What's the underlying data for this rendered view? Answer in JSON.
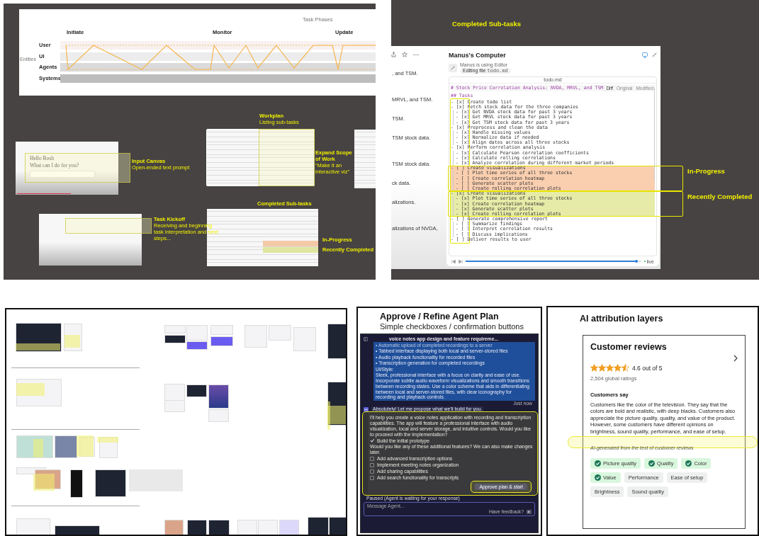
{
  "timeline": {
    "title": "Task Phases",
    "axis_label": "Entities",
    "phases": [
      "Initiate",
      "Monitor",
      "Update"
    ],
    "lanes": [
      "User",
      "UI",
      "Agents",
      "Systems"
    ]
  },
  "welcome": {
    "greeting": "Hello Rosh",
    "question": "What can I do for you?"
  },
  "flow_notes": [
    {
      "title": "Input Canvas",
      "text": "Open-ended text prompt"
    },
    {
      "title": "Task Kickoff",
      "text": "Receiving and beginning task interpretation and next steps..."
    },
    {
      "title": "Workplan",
      "text": "Listing sub-tasks"
    },
    {
      "title": "Expand Scope of Work",
      "text": "“Make it an interactive viz”"
    },
    {
      "title": "Completed Sub-tasks"
    },
    {
      "title": "In-Progress"
    },
    {
      "title": "Recently Completed"
    }
  ],
  "computer": {
    "chat_fragments": [
      ", and TSM.",
      "MRVL, and TSM.",
      "TSM.",
      "TSM stock data.",
      "TSM stock data.",
      "ck data.",
      "alizations.",
      "alizations of NVDA,"
    ],
    "title": "Manus's Computer",
    "status": "Manus is using Editor",
    "action": "Editing file",
    "file": "todo.md",
    "editor_title": "todo.md",
    "view_tabs": [
      {
        "label": "Diff",
        "selected": true
      },
      {
        "label": "Original",
        "selected": false
      },
      {
        "label": "Modified",
        "selected": false
      }
    ],
    "heading": "# Stock Price Correlation Analysis: NVDA, MRVL, and TSM",
    "subheading": "## Tasks",
    "tasks": [
      {
        "text": "- [x] Create todo list",
        "in_progress": false,
        "recently_completed": false
      },
      {
        "text": "- [x] Fetch stock data for the three companies",
        "in_progress": false,
        "recently_completed": false,
        "children": [
          "- [x] Get NVDA stock data for past 3 years",
          "- [x] Get MRVL stock data for past 3 years",
          "- [x] Get TSM stock data for past 3 years"
        ]
      },
      {
        "text": "- [x] Preprocess and clean the data",
        "in_progress": false,
        "recently_completed": false,
        "children": [
          "- [x] Handle missing values",
          "- [x] Normalize data if needed",
          "- [x] Align dates across all three stocks"
        ]
      },
      {
        "text": "- [x] Perform correlation analysis",
        "in_progress": false,
        "recently_completed": false,
        "children": [
          "- [x] Calculate Pearson correlation coefficients",
          "- [x] Calculate rolling correlations",
          "- [x] Analyze correlation during different market periods"
        ]
      },
      {
        "text": "- [ ] Create visualizations",
        "in_progress": true,
        "recently_completed": false,
        "children": [
          "- [ ] Plot time series of all three stocks",
          "- [ ] Create correlation heatmap",
          "- [ ] Generate scatter plots",
          "- [ ] Create rolling correlation plots"
        ]
      },
      {
        "text": "- [x] Create visualizations",
        "in_progress": false,
        "recently_completed": true,
        "children": [
          "- [x] Plot time series of all three stocks",
          "- [x] Create correlation heatmap",
          "- [x] Generate scatter plots",
          "- [x] Create rolling correlation plots"
        ]
      },
      {
        "text": "- [ ] Generate comprehensive report",
        "in_progress": false,
        "recently_completed": false,
        "children": [
          "- [ ] Summarize findings",
          "- [ ] Interpret correlation results",
          "- [ ] Discuss implications"
        ]
      },
      {
        "text": "- [ ] Deliver results to user",
        "in_progress": false,
        "recently_completed": false
      }
    ],
    "playback": {
      "level": 0.97,
      "label": "live"
    },
    "callouts": [
      {
        "kind": "column",
        "label": "Completed Sub-tasks"
      },
      {
        "kind": "in_progress",
        "label": "In-Progress"
      },
      {
        "kind": "recent",
        "label": "Recently Completed"
      }
    ]
  },
  "plan": {
    "title": "Approve / Refine Agent Plan",
    "subtitle": "Simple checkboxes / confirmation buttons",
    "chat_title": "voice notes app design and feature requireme...",
    "bullets": [
      "• Automatic upload of completed recordings to a server",
      "• Tabbed interface displaying both local and server-stored files",
      "• Audio playback functionality for recorded files",
      "• Transcription generation for completed recordings"
    ],
    "style_label": "UI/Style:",
    "style_text": "Sleek, professional interface with a focus on clarity and ease of use. Incorporate subtle audio waveform visualizations and smooth transitions between recording states. Use a color scheme that aids in differentiating between local and server-stored files, with clear iconography for recording and playback controls.",
    "time": "Just now",
    "reply_intro": "Absolutely! Let me propose what we'll build for you.",
    "reply_text": "I'll help you create a voice notes application with recording and transcription capabilities. The app will feature a professional interface with audio visualization, local and server storage, and intuitive controls. Would you like to proceed with the implementation?",
    "base_option": {
      "label": "Build the initial prototype",
      "checked": true
    },
    "extra_prompt": "Would you like any of these additional features? We can also make changes later.",
    "options": [
      {
        "label": "Add advanced transcription options",
        "checked": false
      },
      {
        "label": "Implement meeting notes organization",
        "checked": false
      },
      {
        "label": "Add sharing capabilities",
        "checked": false
      },
      {
        "label": "Add search functionality for transcripts",
        "checked": false
      }
    ],
    "approve_button": "Approve plan & start",
    "status": "Paused (Agent is waiting for your response)",
    "placeholder": "Message Agent...",
    "feedback": "Have feedback?"
  },
  "reviews": {
    "section_title": "AI attribution layers",
    "title": "Customer reviews",
    "stars": 4.5,
    "rating": "4.6 out of 5",
    "count": "2,504 global ratings",
    "summary_title": "Customers say",
    "summary": "Customers like the color of the television. They say that the colors are bold and realistic, with deep blacks. Customers also appreciate the picture quality, quality, and value of the product. However, some customers have different opinions on brightness, sound quality, performance, and ease of setup.",
    "attribution": "AI-generated from the text of customer reviews",
    "tags": [
      {
        "label": "Picture quality",
        "kind": "positive"
      },
      {
        "label": "Quality",
        "kind": "positive"
      },
      {
        "label": "Color",
        "kind": "positive"
      },
      {
        "label": "Value",
        "kind": "positive"
      },
      {
        "label": "Performance",
        "kind": "neutral"
      },
      {
        "label": "Ease of setup",
        "kind": "neutral"
      },
      {
        "label": "Brightness",
        "kind": "neutral"
      },
      {
        "label": "Sound quality",
        "kind": "neutral"
      }
    ]
  }
}
